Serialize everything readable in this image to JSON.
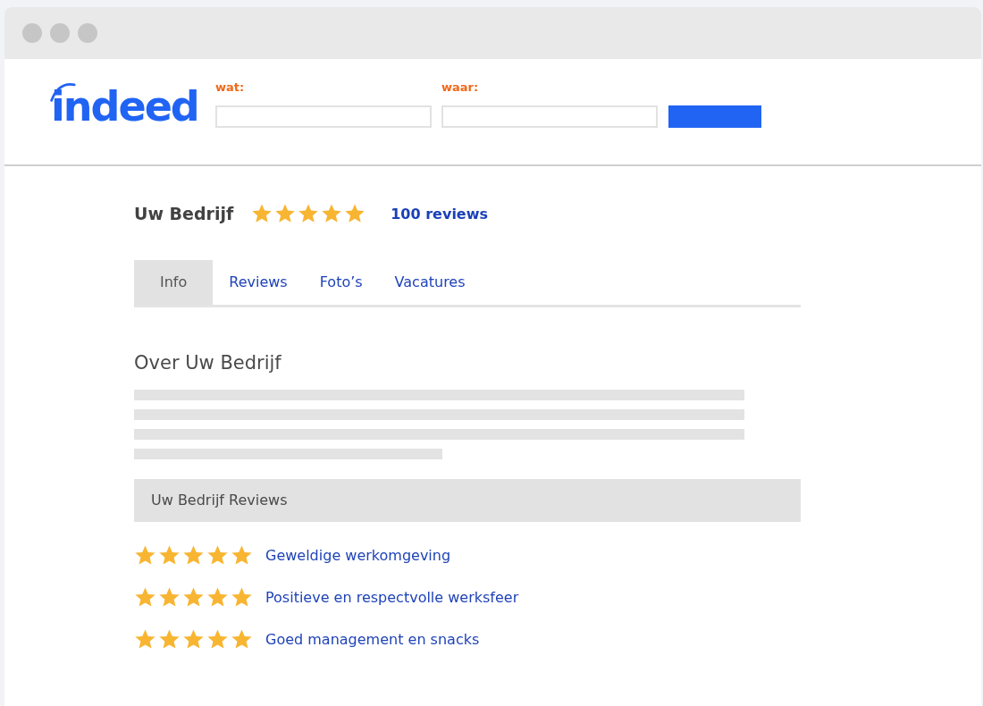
{
  "header": {
    "logo": "indeed",
    "search": [
      {
        "label": "wat:"
      },
      {
        "label": "waar:"
      }
    ]
  },
  "company": {
    "name": "Uw Bedrijf",
    "stars": 5,
    "review_count": "100 reviews"
  },
  "tabs": [
    {
      "label": "Info",
      "selected": true
    },
    {
      "label": "Reviews",
      "selected": false
    },
    {
      "label": "Foto’s",
      "selected": false
    },
    {
      "label": "Vacatures",
      "selected": false
    }
  ],
  "about": {
    "title": "Over Uw Bedrijf"
  },
  "reviews": {
    "title": "Uw Bedrijf Reviews",
    "items": [
      {
        "stars": 5,
        "text": "Geweldige werkomgeving"
      },
      {
        "stars": 5,
        "text": "Positieve en respectvolle werksfeer"
      },
      {
        "stars": 5,
        "text": "Goed management en snacks"
      }
    ]
  }
}
